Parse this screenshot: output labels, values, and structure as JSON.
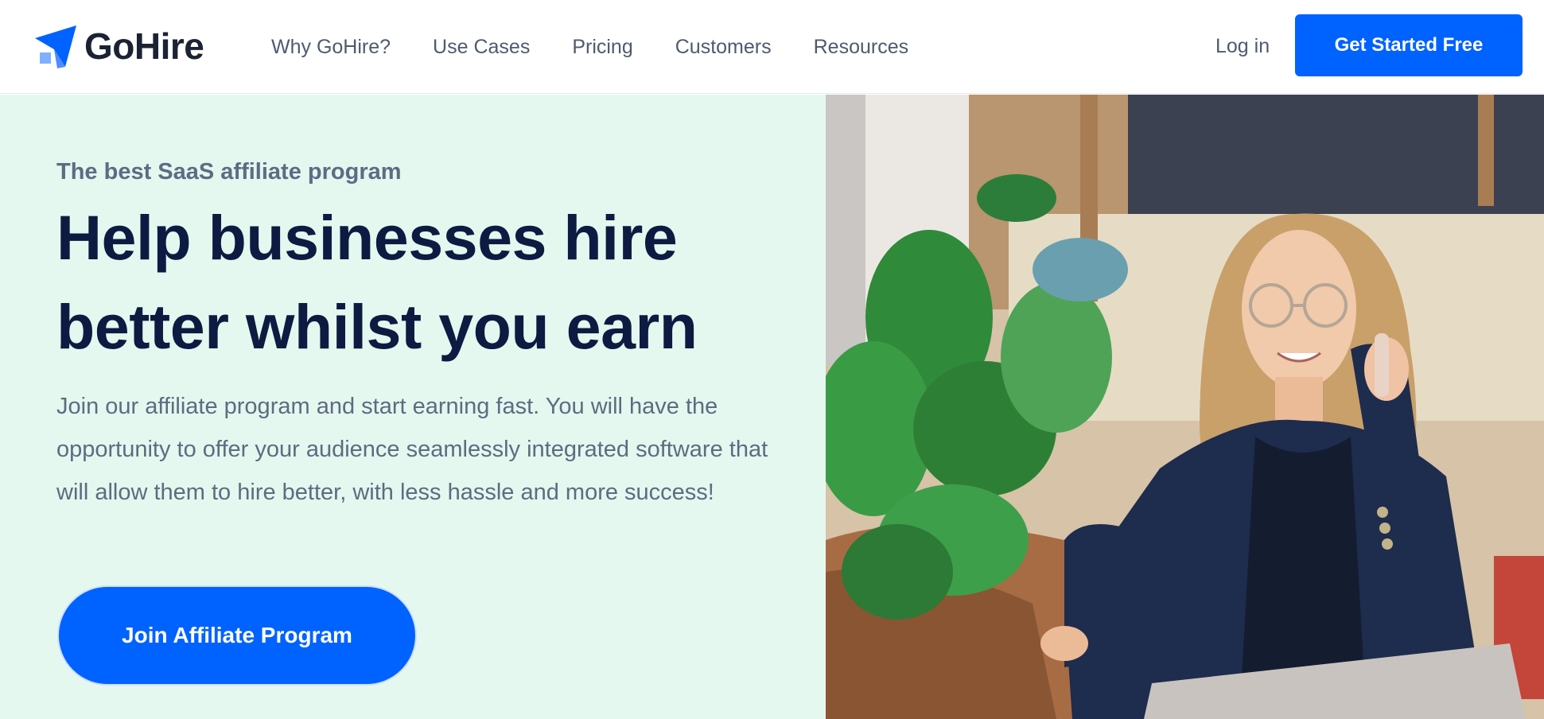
{
  "header": {
    "brand": "GoHire",
    "nav": [
      "Why GoHire?",
      "Use Cases",
      "Pricing",
      "Customers",
      "Resources"
    ],
    "login_label": "Log in",
    "cta_label": "Get Started Free"
  },
  "hero": {
    "eyebrow": "The best SaaS affiliate program",
    "headline_line1": "Help businesses hire",
    "headline_line2": "better whilst you earn",
    "lead": "Join our affiliate program and start earning fast. You will have the opportunity to offer your audience seamlessly integrated software that will allow them to hire better, with less hassle and more success!",
    "cta_label": "Join Affiliate Program"
  },
  "colors": {
    "brand_blue": "#0062ff",
    "hero_bg": "#e4f8ef",
    "heading": "#0d1b42",
    "body_text": "#5f6b80"
  },
  "icons": {
    "logo": "paper-plane-icon"
  }
}
